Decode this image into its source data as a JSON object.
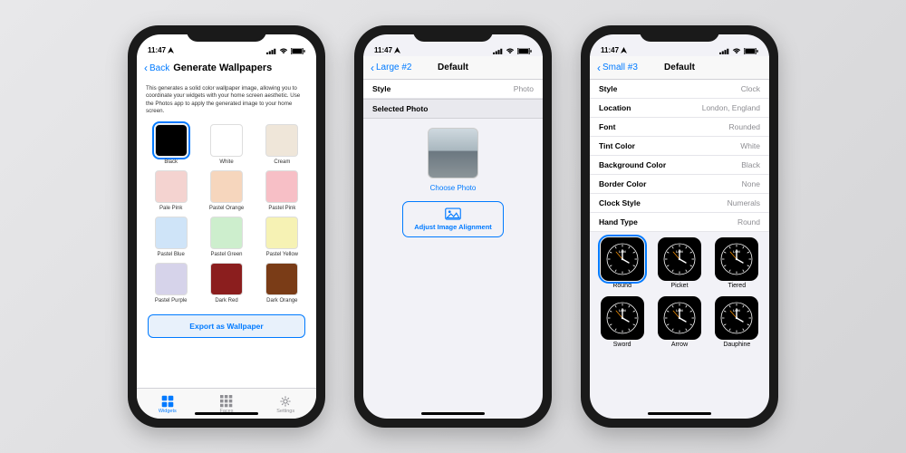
{
  "status": {
    "time": "11:47",
    "loc_icon": "location-icon",
    "signal": 4,
    "wifi": 3,
    "battery": 100
  },
  "phone1": {
    "back_label": "Back",
    "title": "Generate Wallpapers",
    "description": "This generates a solid color wallpaper image, allowing you to coordinate your widgets with your home screen aesthetic. Use the Photos app to apply the generated image to your home screen.",
    "colors": [
      {
        "name": "Black",
        "hex": "#000000",
        "selected": true
      },
      {
        "name": "White",
        "hex": "#ffffff"
      },
      {
        "name": "Cream",
        "hex": "#efe6d9"
      },
      {
        "name": "Pale Pink",
        "hex": "#f4d3d0"
      },
      {
        "name": "Pastel Orange",
        "hex": "#f6d6bd"
      },
      {
        "name": "Pastel Pink",
        "hex": "#f7bfc6"
      },
      {
        "name": "Pastel Blue",
        "hex": "#cfe4f8"
      },
      {
        "name": "Pastel Green",
        "hex": "#cdeecd"
      },
      {
        "name": "Pastel Yellow",
        "hex": "#f6f2b4"
      },
      {
        "name": "Pastel Purple",
        "hex": "#d6d3ea"
      },
      {
        "name": "Dark Red",
        "hex": "#8b1e1e"
      },
      {
        "name": "Dark Orange",
        "hex": "#7a3c17"
      }
    ],
    "export_label": "Export as Wallpaper",
    "tabs": [
      {
        "label": "Widgets",
        "active": true
      },
      {
        "label": "Faces",
        "active": false
      },
      {
        "label": "Settings",
        "active": false
      }
    ]
  },
  "phone2": {
    "back_label": "Large #2",
    "title": "Default",
    "rows": [
      {
        "key": "Style",
        "value": "Photo"
      }
    ],
    "section": "Selected Photo",
    "choose_label": "Choose Photo",
    "adjust_label": "Adjust Image Alignment"
  },
  "phone3": {
    "back_label": "Small #3",
    "title": "Default",
    "rows": [
      {
        "key": "Style",
        "value": "Clock"
      },
      {
        "key": "Location",
        "value": "London, England"
      },
      {
        "key": "Font",
        "value": "Rounded"
      },
      {
        "key": "Tint Color",
        "value": "White"
      },
      {
        "key": "Background Color",
        "value": "Black"
      },
      {
        "key": "Border Color",
        "value": "None"
      },
      {
        "key": "Clock Style",
        "value": "Numerals"
      },
      {
        "key": "Hand Type",
        "value": "Round"
      }
    ],
    "clocks_row1": [
      {
        "name": "Round",
        "selected": true
      },
      {
        "name": "Picket"
      },
      {
        "name": "Tiered"
      }
    ],
    "clocks_row2": [
      {
        "name": "Sword"
      },
      {
        "name": "Arrow"
      },
      {
        "name": "Dauphine"
      }
    ],
    "clock_city_code": "LON"
  }
}
